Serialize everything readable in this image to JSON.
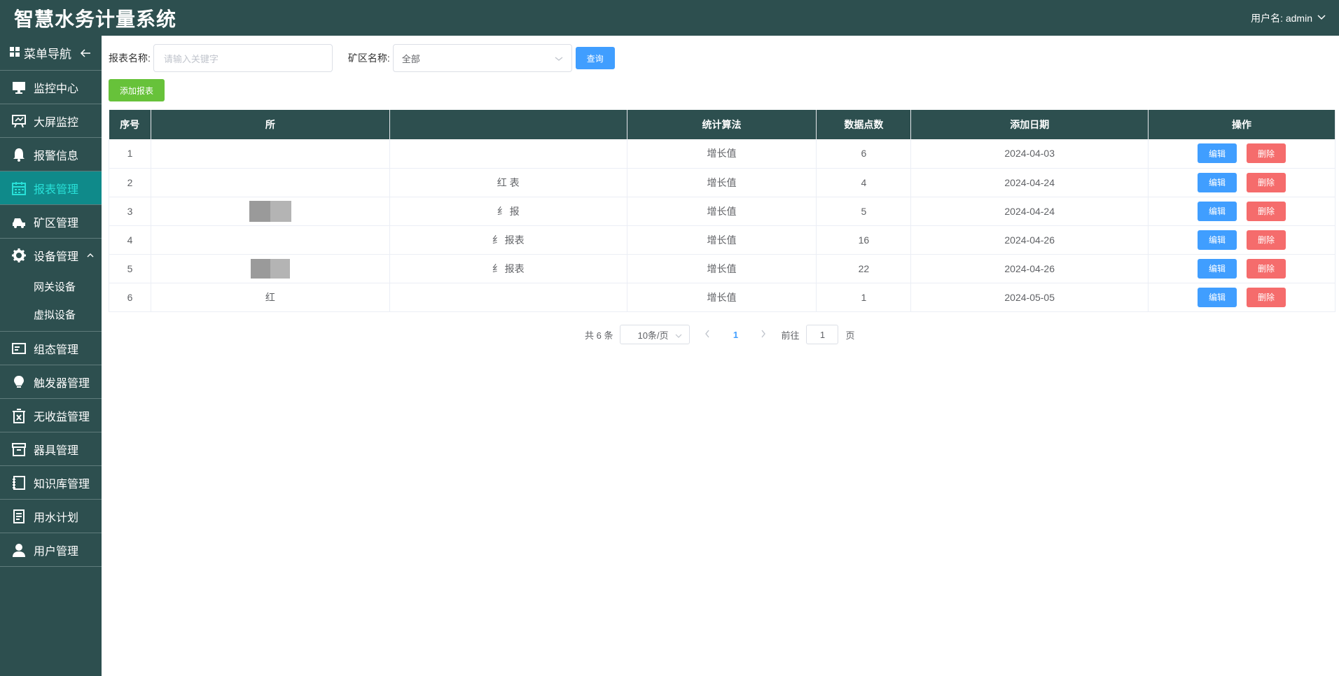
{
  "header": {
    "title": "智慧水务计量系统",
    "user_label": "用户名: admin"
  },
  "sidebar": {
    "heading": "菜单导航",
    "items": [
      {
        "label": "监控中心",
        "icon": "monitor-icon",
        "active": false
      },
      {
        "label": "大屏监控",
        "icon": "easel-icon",
        "active": false
      },
      {
        "label": "报警信息",
        "icon": "bell-icon",
        "active": false
      },
      {
        "label": "报表管理",
        "icon": "calendar-icon",
        "active": true
      },
      {
        "label": "矿区管理",
        "icon": "car-icon",
        "active": false
      },
      {
        "label": "设备管理",
        "icon": "gear-icon",
        "active": false,
        "expanded": true,
        "children": [
          {
            "label": "网关设备"
          },
          {
            "label": "虚拟设备"
          }
        ]
      },
      {
        "label": "组态管理",
        "icon": "card-icon",
        "active": false
      },
      {
        "label": "触发器管理",
        "icon": "bulb-icon",
        "active": false
      },
      {
        "label": "无收益管理",
        "icon": "trash-icon",
        "active": false
      },
      {
        "label": "器具管理",
        "icon": "box-icon",
        "active": false
      },
      {
        "label": "知识库管理",
        "icon": "notebook-icon",
        "active": false
      },
      {
        "label": "用水计划",
        "icon": "document-icon",
        "active": false
      },
      {
        "label": "用户管理",
        "icon": "user-icon",
        "active": false
      }
    ]
  },
  "filters": {
    "report_name_label": "报表名称:",
    "report_name_placeholder": "请输入关键字",
    "mine_label": "矿区名称:",
    "mine_value": "全部",
    "query_label": "查询",
    "add_label": "添加报表"
  },
  "table": {
    "headers": [
      "序号",
      "所",
      "",
      "统计算法",
      "数据点数",
      "添加日期",
      "操作"
    ],
    "rows": [
      {
        "idx": "1",
        "col2": "",
        "col3": "",
        "algo": "增长值",
        "points": "6",
        "date": "2024-04-03"
      },
      {
        "idx": "2",
        "col2": "",
        "col3": "红 表",
        "algo": "增长值",
        "points": "4",
        "date": "2024-04-24"
      },
      {
        "idx": "3",
        "col2": "",
        "col3": "纟 报",
        "algo": "增长值",
        "points": "5",
        "date": "2024-04-24"
      },
      {
        "idx": "4",
        "col2": "",
        "col3": "纟 报表",
        "algo": "增长值",
        "points": "16",
        "date": "2024-04-26"
      },
      {
        "idx": "5",
        "col2": "",
        "col3": "纟 报表",
        "algo": "增长值",
        "points": "22",
        "date": "2024-04-26"
      },
      {
        "idx": "6",
        "col2": "红",
        "col3": "",
        "algo": "增长值",
        "points": "1",
        "date": "2024-05-05"
      }
    ],
    "edit_label": "编辑",
    "delete_label": "删除"
  },
  "pagination": {
    "total": "共 6 条",
    "page_size": "10条/页",
    "current_page": "1",
    "goto_label": "前往",
    "goto_value": "1",
    "page_suffix": "页"
  },
  "colors": {
    "header_bg": "#2d4f4f",
    "sidebar_bg": "#2d4f4f",
    "active_bg": "#0f8a8a",
    "active_text": "#28e0d8",
    "primary": "#409eff",
    "danger": "#f56c6c",
    "success": "#67c23a"
  }
}
